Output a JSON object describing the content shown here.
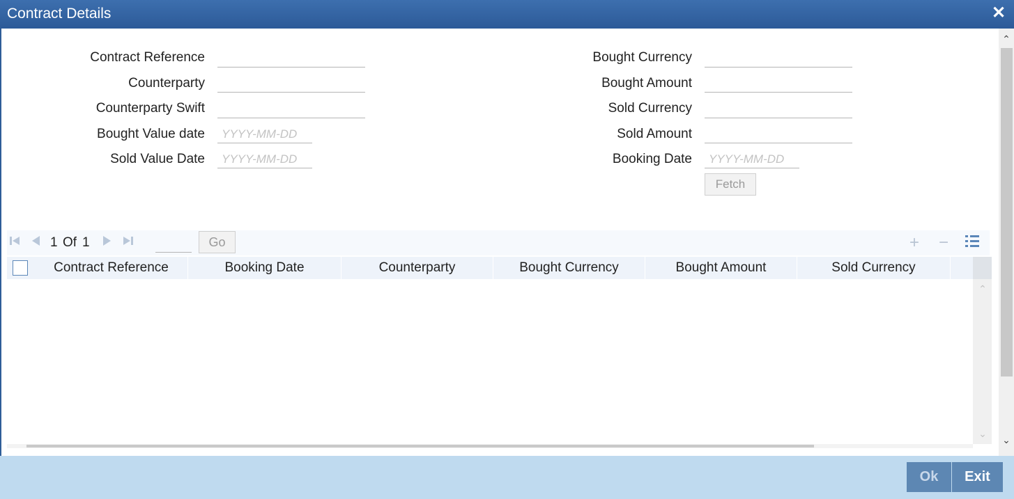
{
  "window": {
    "title": "Contract Details"
  },
  "form": {
    "left": [
      {
        "label": "Contract Reference",
        "value": "",
        "placeholder": ""
      },
      {
        "label": "Counterparty",
        "value": "",
        "placeholder": ""
      },
      {
        "label": "Counterparty Swift",
        "value": "",
        "placeholder": ""
      },
      {
        "label": "Bought Value date",
        "value": "",
        "placeholder": "YYYY-MM-DD"
      },
      {
        "label": "Sold Value Date",
        "value": "",
        "placeholder": "YYYY-MM-DD"
      }
    ],
    "right": [
      {
        "label": "Bought Currency",
        "value": "",
        "placeholder": ""
      },
      {
        "label": "Bought Amount",
        "value": "",
        "placeholder": ""
      },
      {
        "label": "Sold Currency",
        "value": "",
        "placeholder": ""
      },
      {
        "label": "Sold Amount",
        "value": "",
        "placeholder": ""
      },
      {
        "label": "Booking Date",
        "value": "",
        "placeholder": "YYYY-MM-DD"
      }
    ],
    "fetch_label": "Fetch"
  },
  "pagination": {
    "current": "1",
    "of_label": "Of",
    "total": "1",
    "go_label": "Go"
  },
  "grid": {
    "columns": [
      "Contract Reference",
      "Booking Date",
      "Counterparty",
      "Bought Currency",
      "Bought Amount",
      "Sold Currency"
    ],
    "rows": []
  },
  "footer": {
    "ok_label": "Ok",
    "exit_label": "Exit"
  },
  "icons": {
    "close": "close-icon",
    "first": "first-page-icon",
    "prev": "prev-page-icon",
    "next": "next-page-icon",
    "last": "last-page-icon",
    "add": "add-row-icon",
    "remove": "remove-row-icon",
    "columns": "column-settings-icon"
  }
}
